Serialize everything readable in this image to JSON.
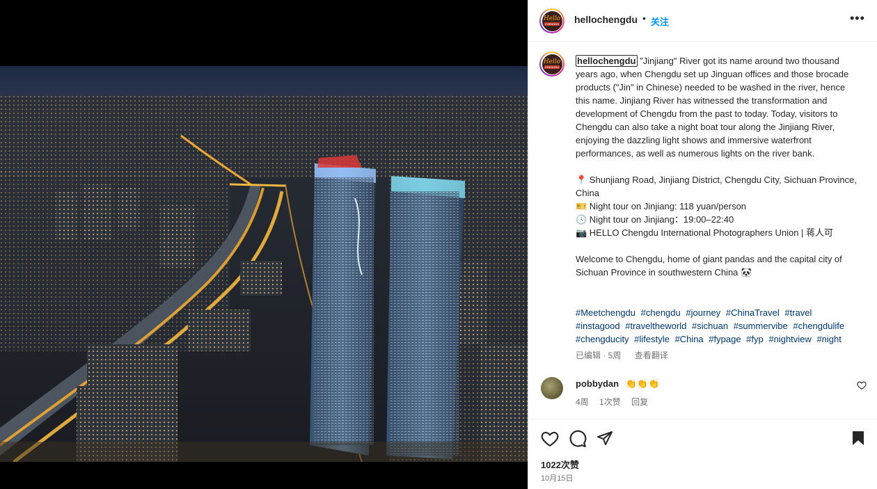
{
  "post": {
    "username": "hellochengdu",
    "follow_label": "关注",
    "more_label": "•••",
    "avatar_text_main": "Hello",
    "avatar_text_sub": "CHENGDU"
  },
  "caption": {
    "username": "hellochengdu",
    "text": " \"Jinjiang\" River got its name around two thousand years ago, when Chengdu set up Jinguan offices and those brocade products (\"Jin\" in Chinese) needed to be washed in the river, hence this name. Jinjiang River has witnessed the transformation and development of Chengdu from the past to today. Today, visitors to Chengdu can also take a night boat tour along the Jinjiang River, enjoying the dazzling light shows and immersive waterfront performances, as well as numerous lights on the river bank.\n\n📍 Shunjiang Road, Jinjiang District, Chengdu City, Sichuan Province, China\n🎫 Night tour on Jinjiang: 118 yuan/person\n🕓 Night tour on Jinjiang：19:00–22:40\n📷 HELLO Chengdu International Photographers Union | 蒋人可\n\nWelcome to Chengdu, home of giant pandas and the capital city of Sichuan Province in southwestern China 🐼"
  },
  "hashtags": [
    "#Meetchengdu",
    "#chengdu",
    "#journey",
    "#ChinaTravel",
    "#travel",
    "#instagood",
    "#traveltheworld",
    "#sichuan",
    "#summervibe",
    "#chengdulife",
    "#chengducity",
    "#lifestyle",
    "#China",
    "#fypage",
    "#fyp",
    "#nightview",
    "#night"
  ],
  "caption_meta": {
    "edited": "已编辑 · 5周",
    "translate": "查看翻译"
  },
  "comment": {
    "username": "pobbydan",
    "text": "👏👏👏",
    "time": "4周",
    "likes": "1次赞",
    "reply": "回复"
  },
  "likes_count": "1022次赞",
  "post_date": "10月15日",
  "colors": {
    "link": "#00376b",
    "follow": "#0095f6",
    "muted": "#737373"
  }
}
